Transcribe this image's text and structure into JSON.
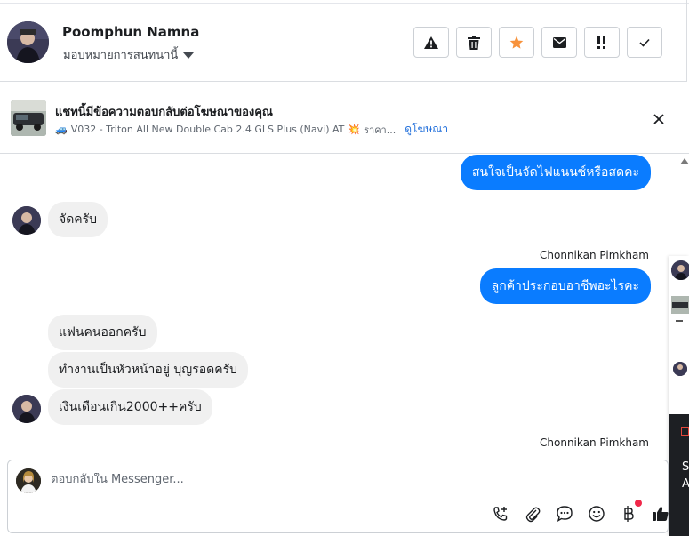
{
  "header": {
    "contact_name": "Poomphun Namna",
    "assign_label": "มอบหมายการสนทนานี้",
    "actions": [
      {
        "icon": "warning-icon"
      },
      {
        "icon": "trash-icon"
      },
      {
        "icon": "star-icon"
      },
      {
        "icon": "envelope-icon"
      },
      {
        "icon": "urgent-icon"
      },
      {
        "icon": "check-icon"
      }
    ]
  },
  "banner": {
    "title": "แชทนี้มีข้อความตอบกลับต่อโฆษณาของคุณ",
    "emoji_car": "🚙",
    "subtitle": "V032 - Triton All New Double Cab 2.4 GLS Plus (Navi) AT",
    "emoji_spark": "💥",
    "subtitle_more": "ราคา...",
    "link": "ดูโฆษณา"
  },
  "messages": {
    "out_1": "สนใจเป็นจัดไฟแนนซ์หรือสดคะ",
    "in_1": "จัดครับ",
    "sender_1": "Chonnikan Pimkham",
    "out_2": "ลูกค้าประกอบอาชีพอะไรคะ",
    "in_2": "แฟนคนออกครับ",
    "in_3": "ทำงานเป็นหัวหน้าอยู่ บุญรอดครับ",
    "in_4": "เงินเดือนเกิน2000++ครับ",
    "sender_2": "Chonnikan Pimkham"
  },
  "side_panel": {
    "text_1": "S",
    "text_2": "A"
  },
  "composer": {
    "placeholder": "ตอบกลับใน Messenger...",
    "tools": [
      "call-add-icon",
      "attach-icon",
      "saved-reply-icon",
      "emoji-icon",
      "baht-icon",
      "like-icon"
    ]
  },
  "colors": {
    "accent": "#0a7cff",
    "star": "#f7923b",
    "badge": "#f02849",
    "link": "#216fdb"
  }
}
